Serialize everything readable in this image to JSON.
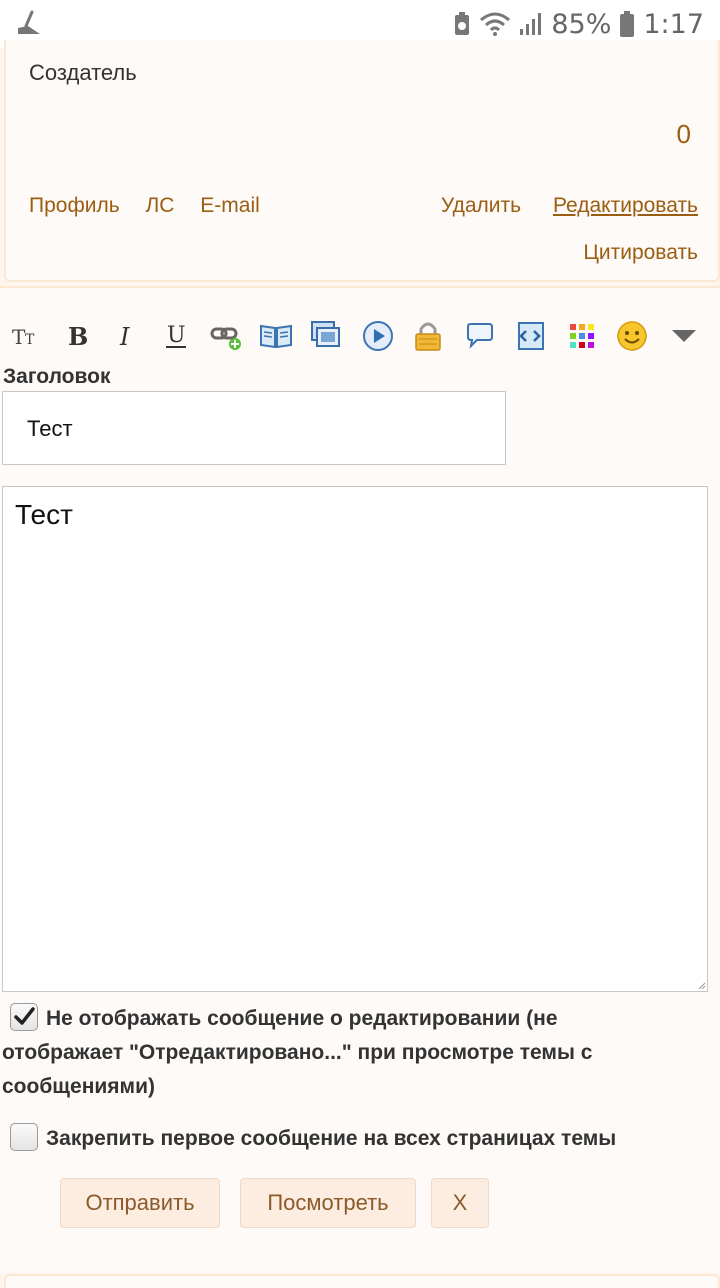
{
  "status_bar": {
    "battery_percent": "85%",
    "time": "1:17"
  },
  "post": {
    "author_role": "Создатель",
    "count": "0",
    "links": [
      "Профиль",
      "ЛС",
      "E-mail"
    ],
    "actions": {
      "delete": "Удалить",
      "edit": "Редактировать"
    },
    "quote": "Цитировать"
  },
  "editor": {
    "toolbar_icons": [
      "font-size-icon",
      "bold-icon",
      "italic-icon",
      "underline-icon",
      "insert-link-icon",
      "book-icon",
      "gallery-icon",
      "video-icon",
      "lock-icon",
      "speech-bubble-icon",
      "code-icon",
      "color-palette-icon",
      "smiley-icon",
      "chevron-down-icon"
    ],
    "title_label": "Заголовок",
    "title_value": "Тест",
    "body_value": "Тест",
    "option_hide_edit_notice": {
      "label": "Не отображать сообщение о редактировании (не отображает \"Отредактировано...\" при просмотре темы с сообщениями)",
      "checked": true
    },
    "option_pin_first": {
      "label": "Закрепить первое сообщение на всех страницах темы",
      "checked": false
    },
    "buttons": {
      "submit": "Отправить",
      "preview": "Посмотреть",
      "close": "X"
    }
  },
  "colors": {
    "link": "#9b5d12",
    "border": "#fbe7d2",
    "background": "#fdfaf7"
  }
}
